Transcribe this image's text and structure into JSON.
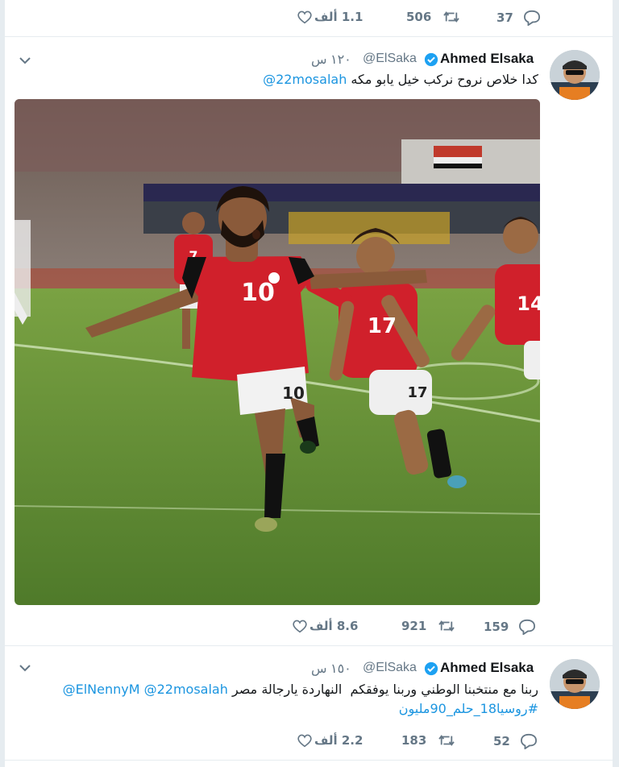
{
  "colors": {
    "link": "#1b95e0",
    "muted": "#657786",
    "verified": "#1da1f2",
    "jersey_red": "#d0202b"
  },
  "tweets": [
    {
      "stats": {
        "likes": "1.1 ألف",
        "retweets": "506",
        "replies": "37"
      }
    },
    {
      "author": {
        "name": "Ahmed Elsaka",
        "handle": "@ElSaka",
        "time": "١٢٠ س"
      },
      "text": {
        "body": "كدا خلاص نروح نركب خيل يابو مكه",
        "mention": "@22mosalah"
      },
      "media": {
        "description": "photo",
        "shirt_number_main": "10",
        "shirt_number_mid": "17",
        "shirt_number_right": "14",
        "shirt_number_back": "7"
      },
      "stats": {
        "likes": "8.6 ألف",
        "retweets": "921",
        "replies": "159"
      }
    },
    {
      "author": {
        "name": "Ahmed Elsaka",
        "handle": "@ElSaka",
        "time": "١٥٠ س"
      },
      "text": {
        "body": "ربنا مع منتخبنا الوطني وربنا يوفقكم  النهاردة يارجالة مصر",
        "mention1": "@22mosalah",
        "mention2": "@ElNennyM",
        "hashtag": "#روسيا18_حلم_90مليون"
      },
      "stats": {
        "likes": "2.2 ألف",
        "retweets": "183",
        "replies": "52"
      }
    }
  ]
}
